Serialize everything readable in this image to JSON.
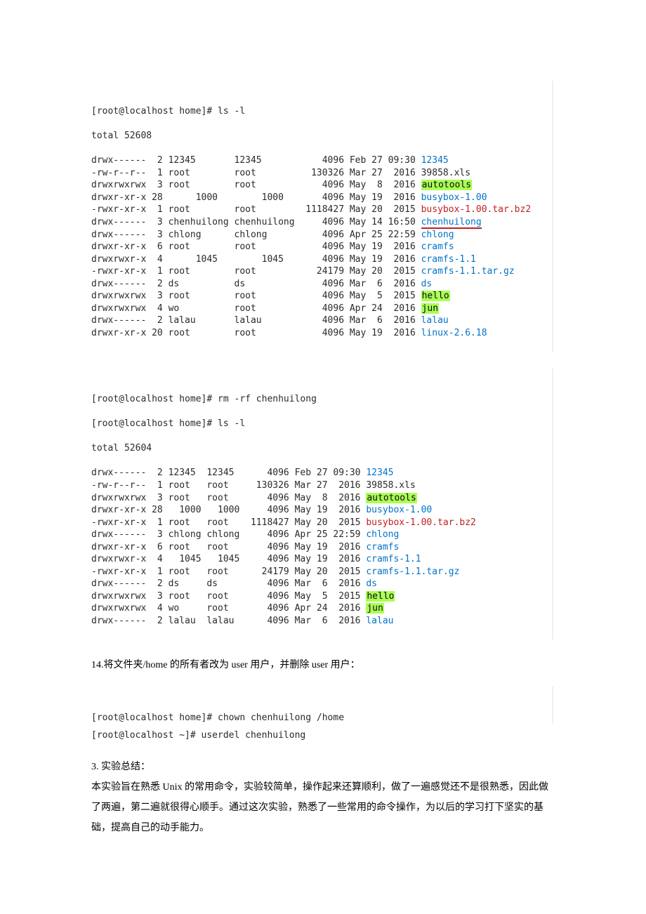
{
  "block1_prompt": "[root@localhost home]# ls -l",
  "block1_total": "total 52608",
  "block1": [
    {
      "perm": "drwx------",
      "ln": " 2",
      "own": "12345      ",
      "grp": "12345      ",
      "size": "    4096",
      "mon": "Feb",
      "day": "27",
      "time": "09:30",
      "name": "12345",
      "cls": "blue"
    },
    {
      "perm": "-rw-r--r--",
      "ln": " 1",
      "own": "root       ",
      "grp": "root       ",
      "size": "  130326",
      "mon": "Mar",
      "day": "27",
      "time": " 2016",
      "name": "39858.xls",
      "cls": ""
    },
    {
      "perm": "drwxrwxrwx",
      "ln": " 3",
      "own": "root       ",
      "grp": "root       ",
      "size": "    4096",
      "mon": "May",
      "day": " 8",
      "time": " 2016",
      "name": "autotools",
      "cls": "hl"
    },
    {
      "perm": "drwxr-xr-x",
      "ln": "28",
      "own": "     1000  ",
      "grp": "     1000  ",
      "size": "    4096",
      "mon": "May",
      "day": "19",
      "time": " 2016",
      "name": "busybox-1.00",
      "cls": "blue"
    },
    {
      "perm": "-rwxr-xr-x",
      "ln": " 1",
      "own": "root       ",
      "grp": "root       ",
      "size": " 1118427",
      "mon": "May",
      "day": "20",
      "time": " 2015",
      "name": "busybox-1.00.tar.bz2",
      "cls": "red"
    },
    {
      "perm": "drwx------",
      "ln": " 3",
      "own": "chenhuilong",
      "grp": "chenhuilong",
      "size": "    4096",
      "mon": "May",
      "day": "14",
      "time": "16:50",
      "name": "chenhuilong",
      "cls": "blue underline-red"
    },
    {
      "perm": "drwx------",
      "ln": " 3",
      "own": "chlong     ",
      "grp": "chlong     ",
      "size": "    4096",
      "mon": "Apr",
      "day": "25",
      "time": "22:59",
      "name": "chlong",
      "cls": "blue"
    },
    {
      "perm": "drwxr-xr-x",
      "ln": " 6",
      "own": "root       ",
      "grp": "root       ",
      "size": "    4096",
      "mon": "May",
      "day": "19",
      "time": " 2016",
      "name": "cramfs",
      "cls": "blue"
    },
    {
      "perm": "drwxrwxr-x",
      "ln": " 4",
      "own": "     1045  ",
      "grp": "     1045  ",
      "size": "    4096",
      "mon": "May",
      "day": "19",
      "time": " 2016",
      "name": "cramfs-1.1",
      "cls": "blue"
    },
    {
      "perm": "-rwxr-xr-x",
      "ln": " 1",
      "own": "root       ",
      "grp": "root       ",
      "size": "   24179",
      "mon": "May",
      "day": "20",
      "time": " 2015",
      "name": "cramfs-1.1.tar.gz",
      "cls": "blue"
    },
    {
      "perm": "drwx------",
      "ln": " 2",
      "own": "ds         ",
      "grp": "ds         ",
      "size": "    4096",
      "mon": "Mar",
      "day": " 6",
      "time": " 2016",
      "name": "ds",
      "cls": "blue"
    },
    {
      "perm": "drwxrwxrwx",
      "ln": " 3",
      "own": "root       ",
      "grp": "root       ",
      "size": "    4096",
      "mon": "May",
      "day": " 5",
      "time": " 2015",
      "name": "hello",
      "cls": "hl"
    },
    {
      "perm": "drwxrwxrwx",
      "ln": " 4",
      "own": "wo         ",
      "grp": "root       ",
      "size": "    4096",
      "mon": "Apr",
      "day": "24",
      "time": " 2016",
      "name": "jun",
      "cls": "hl"
    },
    {
      "perm": "drwx------",
      "ln": " 2",
      "own": "lalau      ",
      "grp": "lalau      ",
      "size": "    4096",
      "mon": "Mar",
      "day": " 6",
      "time": " 2016",
      "name": "lalau",
      "cls": "blue"
    },
    {
      "perm": "drwxr-xr-x",
      "ln": "20",
      "own": "root       ",
      "grp": "root       ",
      "size": "    4096",
      "mon": "May",
      "day": "19",
      "time": " 2016",
      "name": "linux-2.6.18",
      "cls": "blue"
    }
  ],
  "block2_prompt1": "[root@localhost home]# rm -rf chenhuilong",
  "block2_prompt2": "[root@localhost home]# ls -l",
  "block2_total": "total 52604",
  "block2": [
    {
      "perm": "drwx------",
      "ln": " 2",
      "own": "12345 ",
      "grp": "12345 ",
      "size": "    4096",
      "mon": "Feb",
      "day": "27",
      "time": "09:30",
      "name": "12345",
      "cls": "blue"
    },
    {
      "perm": "-rw-r--r--",
      "ln": " 1",
      "own": "root  ",
      "grp": "root  ",
      "size": "  130326",
      "mon": "Mar",
      "day": "27",
      "time": " 2016",
      "name": "39858.xls",
      "cls": ""
    },
    {
      "perm": "drwxrwxrwx",
      "ln": " 3",
      "own": "root  ",
      "grp": "root  ",
      "size": "    4096",
      "mon": "May",
      "day": " 8",
      "time": " 2016",
      "name": "autotools",
      "cls": "hl"
    },
    {
      "perm": "drwxr-xr-x",
      "ln": "28",
      "own": "  1000",
      "grp": "  1000",
      "size": "    4096",
      "mon": "May",
      "day": "19",
      "time": " 2016",
      "name": "busybox-1.00",
      "cls": "blue"
    },
    {
      "perm": "-rwxr-xr-x",
      "ln": " 1",
      "own": "root  ",
      "grp": "root  ",
      "size": " 1118427",
      "mon": "May",
      "day": "20",
      "time": " 2015",
      "name": "busybox-1.00.tar.bz2",
      "cls": "red"
    },
    {
      "perm": "drwx------",
      "ln": " 3",
      "own": "chlong",
      "grp": "chlong",
      "size": "    4096",
      "mon": "Apr",
      "day": "25",
      "time": "22:59",
      "name": "chlong",
      "cls": "blue"
    },
    {
      "perm": "drwxr-xr-x",
      "ln": " 6",
      "own": "root  ",
      "grp": "root  ",
      "size": "    4096",
      "mon": "May",
      "day": "19",
      "time": " 2016",
      "name": "cramfs",
      "cls": "blue"
    },
    {
      "perm": "drwxrwxr-x",
      "ln": " 4",
      "own": "  1045",
      "grp": "  1045",
      "size": "    4096",
      "mon": "May",
      "day": "19",
      "time": " 2016",
      "name": "cramfs-1.1",
      "cls": "blue"
    },
    {
      "perm": "-rwxr-xr-x",
      "ln": " 1",
      "own": "root  ",
      "grp": "root  ",
      "size": "   24179",
      "mon": "May",
      "day": "20",
      "time": " 2015",
      "name": "cramfs-1.1.tar.gz",
      "cls": "blue"
    },
    {
      "perm": "drwx------",
      "ln": " 2",
      "own": "ds    ",
      "grp": "ds    ",
      "size": "    4096",
      "mon": "Mar",
      "day": " 6",
      "time": " 2016",
      "name": "ds",
      "cls": "blue"
    },
    {
      "perm": "drwxrwxrwx",
      "ln": " 3",
      "own": "root  ",
      "grp": "root  ",
      "size": "    4096",
      "mon": "May",
      "day": " 5",
      "time": " 2015",
      "name": "hello",
      "cls": "hl"
    },
    {
      "perm": "drwxrwxrwx",
      "ln": " 4",
      "own": "wo    ",
      "grp": "root  ",
      "size": "    4096",
      "mon": "Apr",
      "day": "24",
      "time": " 2016",
      "name": "jun",
      "cls": "hl"
    },
    {
      "perm": "drwx------",
      "ln": " 2",
      "own": "lalau ",
      "grp": "lalau ",
      "size": "    4096",
      "mon": "Mar",
      "day": " 6",
      "time": " 2016",
      "name": "lalau",
      "cls": "blue"
    }
  ],
  "step14": "14.将文件夹/home 的所有者改为 user 用户，并删除 user 用户：",
  "cmd_chown": "[root@localhost home]# chown chenhuilong /home",
  "cmd_userdel": "[root@localhost ~]# userdel chenhuilong",
  "summary_title": "3. 实验总结：",
  "summary_body": "本实验旨在熟悉 Unix 的常用命令，实验较简单，操作起来还算顺利，做了一遍感觉还不是很熟悉，因此做了两遍，第二遍就很得心顺手。通过这次实验，熟悉了一些常用的命令操作，为以后的学习打下坚实的基础，提高自己的动手能力。"
}
